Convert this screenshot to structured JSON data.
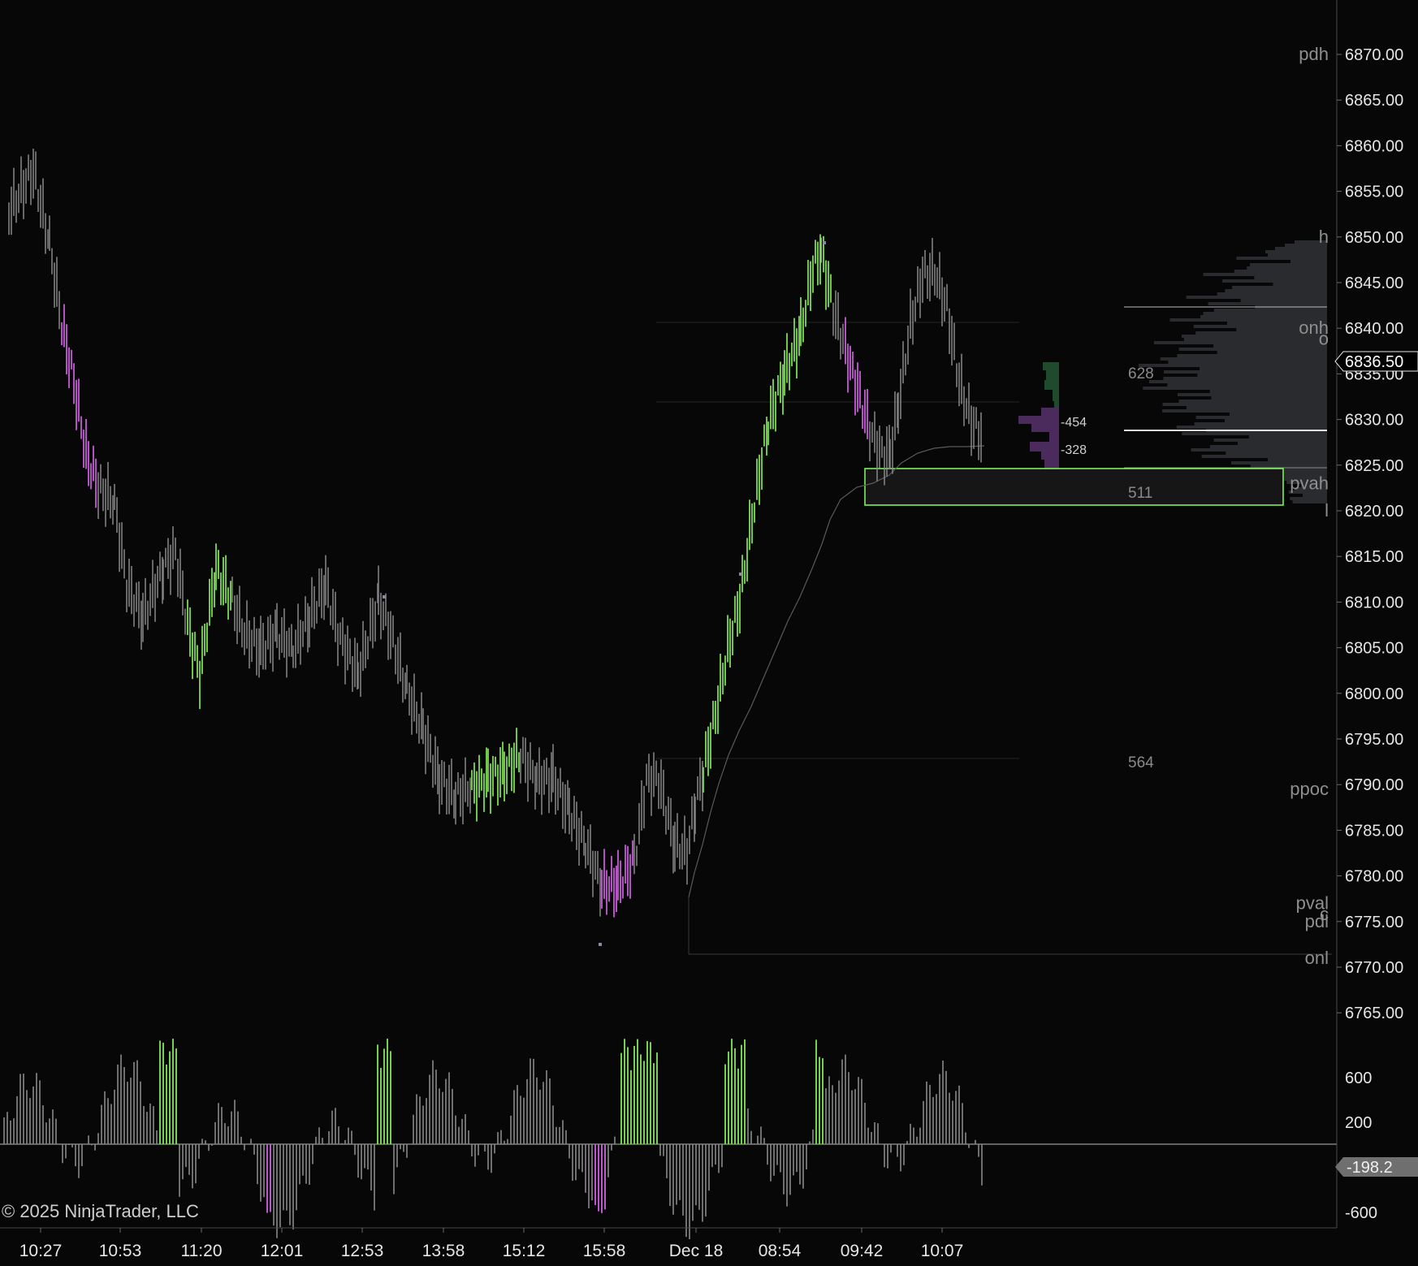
{
  "app": {
    "copyright": "© 2025 NinjaTrader, LLC"
  },
  "colors": {
    "background": "#070707",
    "axis_text": "#e6e6e6",
    "bar_neutral": "#8a8a8a",
    "bar_up": "#7ddc52",
    "bar_down": "#c75cd8",
    "level_label": "#8f8f8f",
    "zone_border": "#7df05a",
    "profile_fill": "#2a2b2e",
    "footprint_green": "#1f4a2e",
    "footprint_purple": "#4b2b5c"
  },
  "price_axis": {
    "ticks": [
      "6870.00",
      "6865.00",
      "6860.00",
      "6855.00",
      "6850.00",
      "6845.00",
      "6840.00",
      "6835.00",
      "6830.00",
      "6825.00",
      "6820.00",
      "6815.00",
      "6810.00",
      "6805.00",
      "6800.00",
      "6795.00",
      "6790.00",
      "6785.00",
      "6780.00",
      "6775.00",
      "6770.00",
      "6765.00"
    ],
    "current_price": "6836.50"
  },
  "time_axis": {
    "ticks": [
      "10:27",
      "10:53",
      "11:20",
      "12:01",
      "12:53",
      "13:58",
      "15:12",
      "15:58",
      "Dec 18",
      "08:54",
      "09:42",
      "10:07"
    ]
  },
  "levels": [
    {
      "label": "pdh",
      "price": 6870.0
    },
    {
      "label": "h",
      "price": 6850.0
    },
    {
      "label": "onh",
      "price": 6840.0
    },
    {
      "label": "o",
      "price": 6838.8
    },
    {
      "label": "pvah",
      "price": 6823.0
    },
    {
      "label": "l",
      "price": 6820.0
    },
    {
      "label": "ppoc",
      "price": 6789.5
    },
    {
      "label": "pval",
      "price": 6777.0
    },
    {
      "label": "c",
      "price": 6775.8
    },
    {
      "label": "pdl",
      "price": 6775.0
    },
    {
      "label": "onl",
      "price": 6771.0
    }
  ],
  "annotations": {
    "profile_value_1": "628",
    "profile_value_2": "511",
    "profile_value_3": "564",
    "footprint_value_1": "-454",
    "footprint_value_2": "-328"
  },
  "indicator": {
    "ticks": [
      "600",
      "200",
      "-600"
    ],
    "current_value": "-198.2"
  }
}
